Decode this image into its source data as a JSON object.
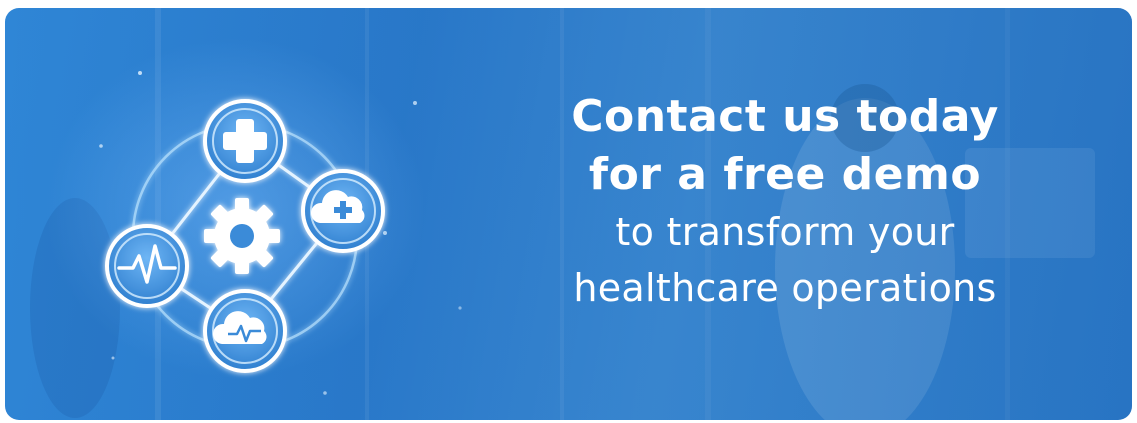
{
  "banner": {
    "headline": {
      "line1": "Contact us today",
      "line2": "for a free demo",
      "line3": "to transform your",
      "line4": "healthcare operations"
    },
    "icons": [
      "medical-cross-icon",
      "cloud-plus-icon",
      "gear-icon",
      "heartbeat-icon",
      "cloud-pulse-icon"
    ]
  },
  "colors": {
    "background": "#2f86d6",
    "text": "#ffffff",
    "icon_glow": "#cfeaff"
  }
}
